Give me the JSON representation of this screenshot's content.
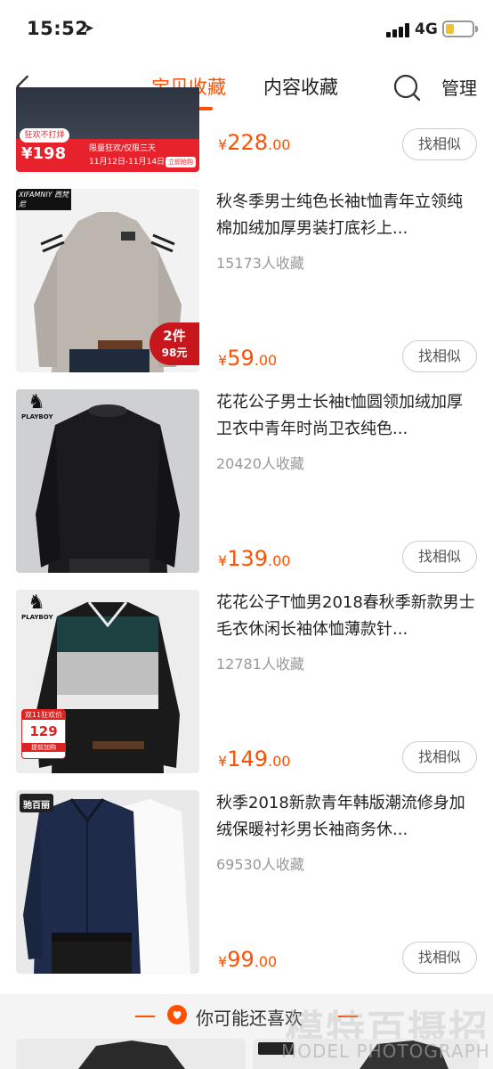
{
  "status_bar": {
    "time": "15:52",
    "network": "4G"
  },
  "nav": {
    "tabs": [
      {
        "label": "宝贝收藏",
        "active": true
      },
      {
        "label": "内容收藏",
        "active": false
      }
    ],
    "manage_label": "管理"
  },
  "items": [
    {
      "title": "",
      "favorites": "",
      "price_int": "228",
      "price_dec": ".00",
      "similar": "找相似",
      "thumb_badge": {
        "top": "狂欢不打烊",
        "price": "198",
        "line1": "限量狂欢/仅限三天",
        "line2": "11月12日-11月14日",
        "btn": "立即抢购"
      }
    },
    {
      "title": "秋冬季男士纯色长袖t恤青年立领纯棉加绒加厚男装打底衫上...",
      "favorites": "15173人收藏",
      "price_int": "59",
      "price_dec": ".00",
      "similar": "找相似",
      "thumb_brand": "XIFAMNIY 西梵尼",
      "thumb_promo": {
        "line1": "2件",
        "line2": "98元"
      }
    },
    {
      "title": "花花公子男士长袖t恤圆领加绒加厚卫衣中青年时尚卫衣纯色...",
      "favorites": "20420人收藏",
      "price_int": "139",
      "price_dec": ".00",
      "similar": "找相似",
      "thumb_brand": "PLAYBOY"
    },
    {
      "title": "花花公子T恤男2018春秋季新款男士毛衣休闲长袖体恤薄款针...",
      "favorites": "12781人收藏",
      "price_int": "149",
      "price_dec": ".00",
      "similar": "找相似",
      "thumb_brand": "PLAYBOY",
      "thumb_promo": {
        "line1": "双11狂欢价",
        "line2": "129",
        "line3": "提前加购"
      }
    },
    {
      "title": "秋季2018新款青年韩版潮流修身加绒保暖衬衫男长袖商务休...",
      "favorites": "69530人收藏",
      "price_int": "99",
      "price_dec": ".00",
      "similar": "找相似",
      "thumb_brand": "驰百丽"
    }
  ],
  "price_symbol": "¥",
  "recommend": {
    "label": "你可能还喜欢"
  },
  "watermark": {
    "big": "模特百摄招",
    "small": "MODEL PHOTOGRAPH"
  },
  "colors": {
    "accent": "#ff5000",
    "muted": "#999999"
  }
}
